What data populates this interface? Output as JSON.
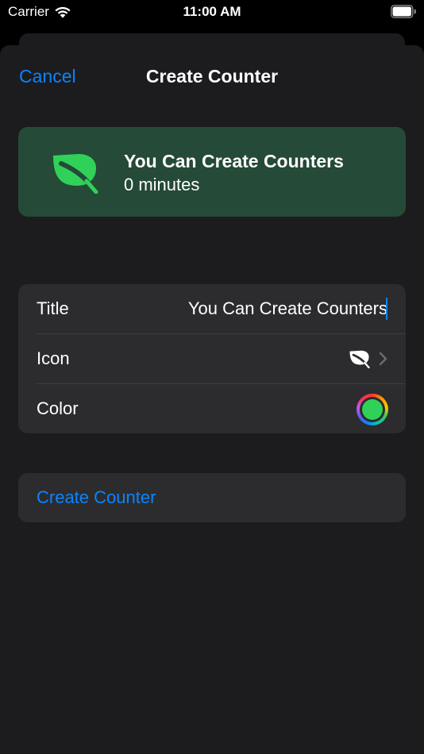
{
  "status_bar": {
    "carrier": "Carrier",
    "time": "11:00 AM",
    "wifi_icon": "wifi-icon",
    "battery_icon": "battery-icon"
  },
  "nav": {
    "cancel_label": "Cancel",
    "title": "Create Counter"
  },
  "preview": {
    "icon": "leaf-icon",
    "title": "You Can Create Counters",
    "subtitle": "0 minutes",
    "background_color": "#254a37",
    "icon_color": "#30d158"
  },
  "form": {
    "title_label": "Title",
    "title_value": "You Can Create Counters",
    "icon_label": "Icon",
    "icon_value": "leaf-icon",
    "color_label": "Color",
    "color_value": "#30d158"
  },
  "actions": {
    "create_label": "Create Counter"
  },
  "colors": {
    "accent": "#0a84ff",
    "sheet": "#1c1c1e",
    "group": "#2c2c2e"
  }
}
